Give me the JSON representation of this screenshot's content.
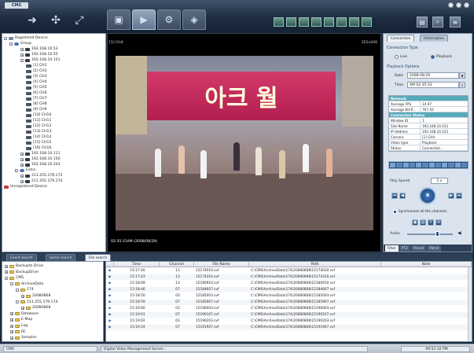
{
  "app": {
    "logo": "CMS"
  },
  "modes": [
    "monitor-icon",
    "playback-icon",
    "config-icon",
    "map-icon"
  ],
  "device_tree": {
    "root_registered": "Registered Device",
    "group": "Group",
    "items": [
      {
        "label": "192.168.10.53",
        "level": 2,
        "type": "dvr"
      },
      {
        "label": "192.168.10.55",
        "level": 2,
        "type": "dvr"
      },
      {
        "label": "192.168.10.151",
        "level": 2,
        "type": "dvr",
        "expanded": true
      },
      {
        "label": "[1] CH1",
        "level": 3,
        "type": "cam"
      },
      {
        "label": "[2] CH2",
        "level": 3,
        "type": "cam"
      },
      {
        "label": "[3] CH3",
        "level": 3,
        "type": "cam"
      },
      {
        "label": "[4] CH4",
        "level": 3,
        "type": "cam"
      },
      {
        "label": "[5] CH5",
        "level": 3,
        "type": "cam"
      },
      {
        "label": "[6] CH6",
        "level": 3,
        "type": "cam"
      },
      {
        "label": "[7] CH7",
        "level": 3,
        "type": "cam"
      },
      {
        "label": "[8] CH8",
        "level": 3,
        "type": "cam"
      },
      {
        "label": "[9] CH9",
        "level": 3,
        "type": "cam"
      },
      {
        "label": "[10] CH10",
        "level": 3,
        "type": "cam"
      },
      {
        "label": "[11] CH11",
        "level": 3,
        "type": "cam"
      },
      {
        "label": "[12] CH12",
        "level": 3,
        "type": "cam"
      },
      {
        "label": "[13] CH13",
        "level": 3,
        "type": "cam"
      },
      {
        "label": "[14] CH14",
        "level": 3,
        "type": "cam"
      },
      {
        "label": "[15] CH15",
        "level": 3,
        "type": "cam"
      },
      {
        "label": "[16] CH16",
        "level": 3,
        "type": "cam"
      },
      {
        "label": "192.168.10.111",
        "level": 2,
        "type": "dvr"
      },
      {
        "label": "192.168.10.150",
        "level": 2,
        "type": "dvr"
      },
      {
        "label": "192.168.10.203",
        "level": 2,
        "type": "dvr"
      },
      {
        "label": "Extra",
        "level": 1,
        "type": "group"
      },
      {
        "label": "211.255.179.173",
        "level": 2,
        "type": "dvr"
      },
      {
        "label": "211.255.179.174",
        "level": 2,
        "type": "dvr"
      },
      {
        "label": "Unregistered Device",
        "level": 0,
        "type": "unreg"
      }
    ]
  },
  "video": {
    "title": "[1] CH4",
    "resolution": "352x240",
    "timestamp": "02:35:31AM (2008/08/29)",
    "sign_text": "아크 월"
  },
  "right_panel": {
    "tabs": [
      "Connection",
      "Information"
    ],
    "connection_type_label": "Connection Type",
    "option_live": "Live",
    "option_playback": "Playback",
    "playback_options_label": "Playback Options",
    "date_label": "Date",
    "date_value": "2008-08-29",
    "time_label": "Time",
    "time_value": "AM 02:35:33",
    "props": [
      {
        "k": "Network",
        "v": "",
        "head": true
      },
      {
        "k": "Average FPS",
        "v": "14.97"
      },
      {
        "k": "Average Bit-R...",
        "v": "767.43"
      },
      {
        "k": "Connection Status",
        "v": "",
        "head": true
      },
      {
        "k": "Window ID",
        "v": "1"
      },
      {
        "k": "Site Name",
        "v": "192.168.10.151"
      },
      {
        "k": "IP Address",
        "v": "192.168.10.151"
      },
      {
        "k": "Camera",
        "v": "[1] CH4"
      },
      {
        "k": "Video type",
        "v": "Playback"
      },
      {
        "k": "Status",
        "v": "Connected..."
      }
    ],
    "play_speed_label": "Play Speed",
    "play_speed_value": "1 x",
    "sync_label": "Synchronize all the channels",
    "audio_label": "Audio",
    "bottom_tabs": [
      "Filter",
      "PTZ",
      "Preset",
      "Patrol"
    ]
  },
  "bottom_tabs": [
    "Event search",
    "Serial search",
    "File search"
  ],
  "folder_tree": [
    {
      "label": "Backupto Drive",
      "level": 0
    },
    {
      "label": "BackupDrive",
      "level": 0
    },
    {
      "label": "CMS",
      "level": 0
    },
    {
      "label": "ArchiveData",
      "level": 1
    },
    {
      "label": "174",
      "level": 2
    },
    {
      "label": "20080808",
      "level": 3
    },
    {
      "label": "211.255.179.174",
      "level": 2
    },
    {
      "label": "20080808",
      "level": 3
    },
    {
      "label": "Database",
      "level": 1
    },
    {
      "label": "E-Map",
      "level": 1
    },
    {
      "label": "Log",
      "level": 1
    },
    {
      "label": "RC",
      "level": 1
    },
    {
      "label": "Samples",
      "level": 1
    }
  ],
  "file_table": {
    "columns": [
      "Time",
      "Channel",
      "File Name",
      "Path",
      "Note"
    ],
    "rows": [
      [
        "15:17:40",
        "13",
        "15174010.svf",
        "C:\\CMS\\ArchiveData\\174\\20080808\\15174010.svf",
        ""
      ],
      [
        "15:17:43",
        "13",
        "15174310.svf",
        "C:\\CMS\\ArchiveData\\174\\20080808\\15174310.svf",
        ""
      ],
      [
        "15:18:09",
        "13",
        "15180910.svf",
        "C:\\CMS\\ArchiveData\\174\\20080808\\15180910.svf",
        ""
      ],
      [
        "15:18:46",
        "07",
        "15184607.svf",
        "C:\\CMS\\ArchiveData\\174\\20080808\\15184607.svf",
        ""
      ],
      [
        "15:18:50",
        "03",
        "15185003.svf",
        "C:\\CMS\\ArchiveData\\174\\20080808\\15185003.svf",
        ""
      ],
      [
        "15:18:59",
        "07",
        "15185907.svf",
        "C:\\CMS\\ArchiveData\\174\\20080808\\15185907.svf",
        ""
      ],
      [
        "15:19:00",
        "03",
        "15190003.svf",
        "C:\\CMS\\ArchiveData\\174\\20080808\\15190003.svf",
        ""
      ],
      [
        "15:19:01",
        "07",
        "15190107.svf",
        "C:\\CMS\\ArchiveData\\174\\20080808\\15190107.svf",
        ""
      ],
      [
        "15:19:02",
        "03",
        "15190203.svf",
        "C:\\CMS\\ArchiveData\\174\\20080808\\15190203.svf",
        ""
      ],
      [
        "15:19:19",
        "07",
        "15191907.svf",
        "C:\\CMS\\ArchiveData\\174\\20080808\\15191907.svf",
        ""
      ]
    ]
  },
  "status": {
    "left": "CMS",
    "middle": "Digital Video Management Server...",
    "right": "09:51:32 PM"
  }
}
